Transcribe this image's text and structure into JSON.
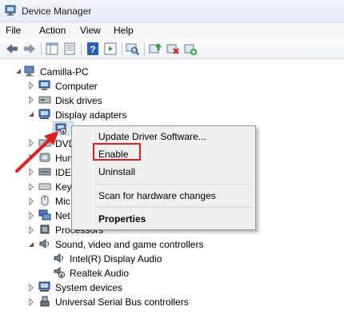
{
  "window": {
    "title": "Device Manager",
    "icon": "device-manager-icon"
  },
  "menu": [
    "File",
    "Action",
    "View",
    "Help"
  ],
  "toolbar": {
    "buttons": [
      "back-arrow-icon",
      "forward-arrow-icon",
      "show-hide-tree-icon",
      "properties-icon",
      "help-icon",
      "action-pane-icon",
      "scan-hardware-icon",
      "update-driver-icon",
      "disable-device-icon",
      "uninstall-device-icon"
    ]
  },
  "tree": {
    "root": "Camilla-PC",
    "items": [
      {
        "label": "Computer",
        "icon": "computer-icon",
        "expanded": false
      },
      {
        "label": "Disk drives",
        "icon": "disk-drive-icon",
        "expanded": false
      },
      {
        "label": "Display adapters",
        "icon": "display-adapter-icon",
        "expanded": true
      },
      {
        "label": "DVD",
        "icon": "dvd-drive-icon",
        "expanded": false
      },
      {
        "label": "Hum",
        "icon": "hid-icon",
        "expanded": false
      },
      {
        "label": "IDE",
        "icon": "ide-controller-icon",
        "expanded": false
      },
      {
        "label": "Key",
        "icon": "keyboard-icon",
        "expanded": false
      },
      {
        "label": "Mic",
        "icon": "mouse-icon",
        "expanded": false
      },
      {
        "label": "Net",
        "icon": "network-adapter-icon",
        "expanded": false
      },
      {
        "label": "Processors",
        "icon": "processor-icon",
        "expanded": false
      },
      {
        "label": "Sound, video and game controllers",
        "icon": "sound-controller-icon",
        "expanded": true
      },
      {
        "label": "System devices",
        "icon": "system-devices-icon",
        "expanded": false
      },
      {
        "label": "Universal Serial Bus controllers",
        "icon": "usb-icon",
        "expanded": false
      }
    ],
    "sound_children": [
      "Intel(R) Display Audio",
      "Realtek Audio"
    ]
  },
  "context_menu": {
    "items": [
      "Update Driver Software...",
      "Enable",
      "Uninstall",
      "Scan for hardware changes",
      "Properties"
    ],
    "highlighted": "Enable"
  },
  "colors": {
    "annotation_red": "#e02020",
    "menu_bg": "#f0f0f0"
  }
}
